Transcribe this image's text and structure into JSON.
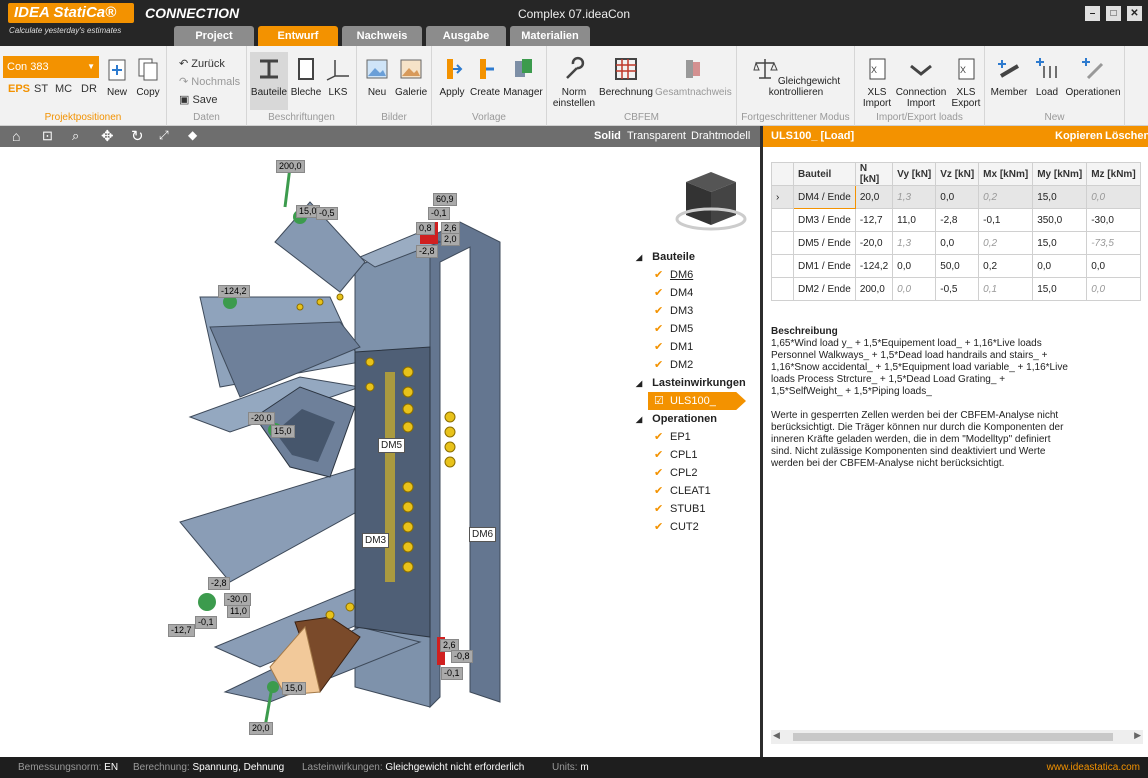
{
  "app": {
    "logo": "IDEA StatiCa®",
    "module": "CONNECTION",
    "tagline": "Calculate yesterday's estimates",
    "window_title": "Complex 07.ideaCon"
  },
  "tabs": [
    "Project",
    "Entwurf",
    "Nachweis",
    "Ausgabe",
    "Materialien"
  ],
  "ribbon": {
    "projekt": {
      "select": "Con 383",
      "codes": [
        "EPS",
        "ST",
        "MC",
        "DR"
      ],
      "new": "New",
      "copy": "Copy",
      "label": "Projektpositionen"
    },
    "daten": {
      "back": "Zurück",
      "redo": "Nochmals",
      "save": "Save",
      "label": "Daten"
    },
    "beschriftungen": {
      "items": [
        "Bauteile",
        "Bleche",
        "LKS"
      ],
      "label": "Beschriftungen"
    },
    "bilder": {
      "items": [
        "Neu",
        "Galerie"
      ],
      "label": "Bilder"
    },
    "vorlage": {
      "items": [
        "Apply",
        "Create",
        "Manager"
      ],
      "label": "Vorlage"
    },
    "cbfem": {
      "norm": "Norm einstellen",
      "items": [
        "Berechnung",
        "Gesamtnachweis"
      ],
      "label": "CBFEM"
    },
    "fort": {
      "item": "Gleichgewicht kontrollieren",
      "label": "Fortgeschrittener Modus"
    },
    "ie": {
      "items": [
        "XLS Import",
        "Connection Import",
        "XLS Export"
      ],
      "label": "Import/Export loads"
    },
    "new": {
      "items": [
        "Member",
        "Load",
        "Operationen"
      ],
      "label": "New"
    }
  },
  "viewbar": {
    "modes": [
      "Solid",
      "Transparent",
      "Drahtmodell"
    ]
  },
  "tree": {
    "bauteile_title": "Bauteile",
    "bauteile": [
      "DM6",
      "DM4",
      "DM3",
      "DM5",
      "DM1",
      "DM2"
    ],
    "last_title": "Lasteinwirkungen",
    "last": "ULS100_",
    "ops_title": "Operationen",
    "ops": [
      "EP1",
      "CPL1",
      "CPL2",
      "CLEAT1",
      "STUB1",
      "CUT2"
    ]
  },
  "model_labels": {
    "dm5": "DM5",
    "dm3": "DM3",
    "dm6": "DM6",
    "values": [
      "200,0",
      "15,0",
      "-0,5",
      "60,9",
      "-0,1",
      "0,8",
      "2,6",
      "2,0",
      "-2,8",
      "-124,2",
      "-20,0",
      "15,0",
      "-2,8",
      "-30,0",
      "11,0",
      "-12,7",
      "-0,1",
      "15,0",
      "20,0",
      "2,6",
      "-0,8",
      "-0,1"
    ]
  },
  "right": {
    "header": "ULS100_  [Load]",
    "copy": "Kopieren",
    "delete": "Löschen",
    "columns": [
      "Bauteil",
      "N [kN]",
      "Vy [kN]",
      "Vz [kN]",
      "Mx [kNm]",
      "My [kNm]",
      "Mz [kNm]"
    ],
    "rows": [
      [
        "DM4 / Ende",
        "20,0",
        "1,3",
        "0,0",
        "0,2",
        "15,0",
        "0,0"
      ],
      [
        "DM3 / Ende",
        "-12,7",
        "11,0",
        "-2,8",
        "-0,1",
        "350,0",
        "-30,0"
      ],
      [
        "DM5 / Ende",
        "-20,0",
        "1,3",
        "0,0",
        "0,2",
        "15,0",
        "-73,5"
      ],
      [
        "DM1 / Ende",
        "-124,2",
        "0,0",
        "50,0",
        "0,2",
        "0,0",
        "0,0"
      ],
      [
        "DM2 / Ende",
        "200,0",
        "0,0",
        "-0,5",
        "0,1",
        "15,0",
        "0,0"
      ]
    ],
    "desc_title": "Beschreibung",
    "desc": "1,65*Wind load y_ + 1,5*Equipement load_ + 1,16*Live loads Personnel Walkways_ + 1,5*Dead load handrails and stairs_ + 1,16*Snow accidental_ + 1,5*Equipment load variable_ + 1,16*Live loads Process Strcture_ + 1,5*Dead Load Grating_ + 1,5*SelfWeight_ + 1,5*Piping loads_",
    "note": "Werte in gesperrten Zellen werden bei der CBFEM-Analyse nicht berücksichtigt. Die Träger können nur durch die Komponenten der inneren Kräfte geladen werden, die in dem  \"Modelltyp\" definiert sind. Nicht zulässige Komponenten sind deaktiviert und Werte werden bei der CBFEM-Analyse nicht berücksichtigt."
  },
  "status": {
    "norm_l": "Bemessungsnorm:",
    "norm": "EN",
    "calc_l": "Berechnung:",
    "calc": "Spannung, Dehnung",
    "last_l": "Lasteinwirkungen:",
    "last": "Gleichgewicht nicht erforderlich",
    "units_l": "Units:",
    "units": "m",
    "web": "www.ideastatica.com"
  },
  "colors": {
    "accent": "#f39200",
    "steel": "#7d8fa6",
    "bolt": "#e8c21a"
  }
}
